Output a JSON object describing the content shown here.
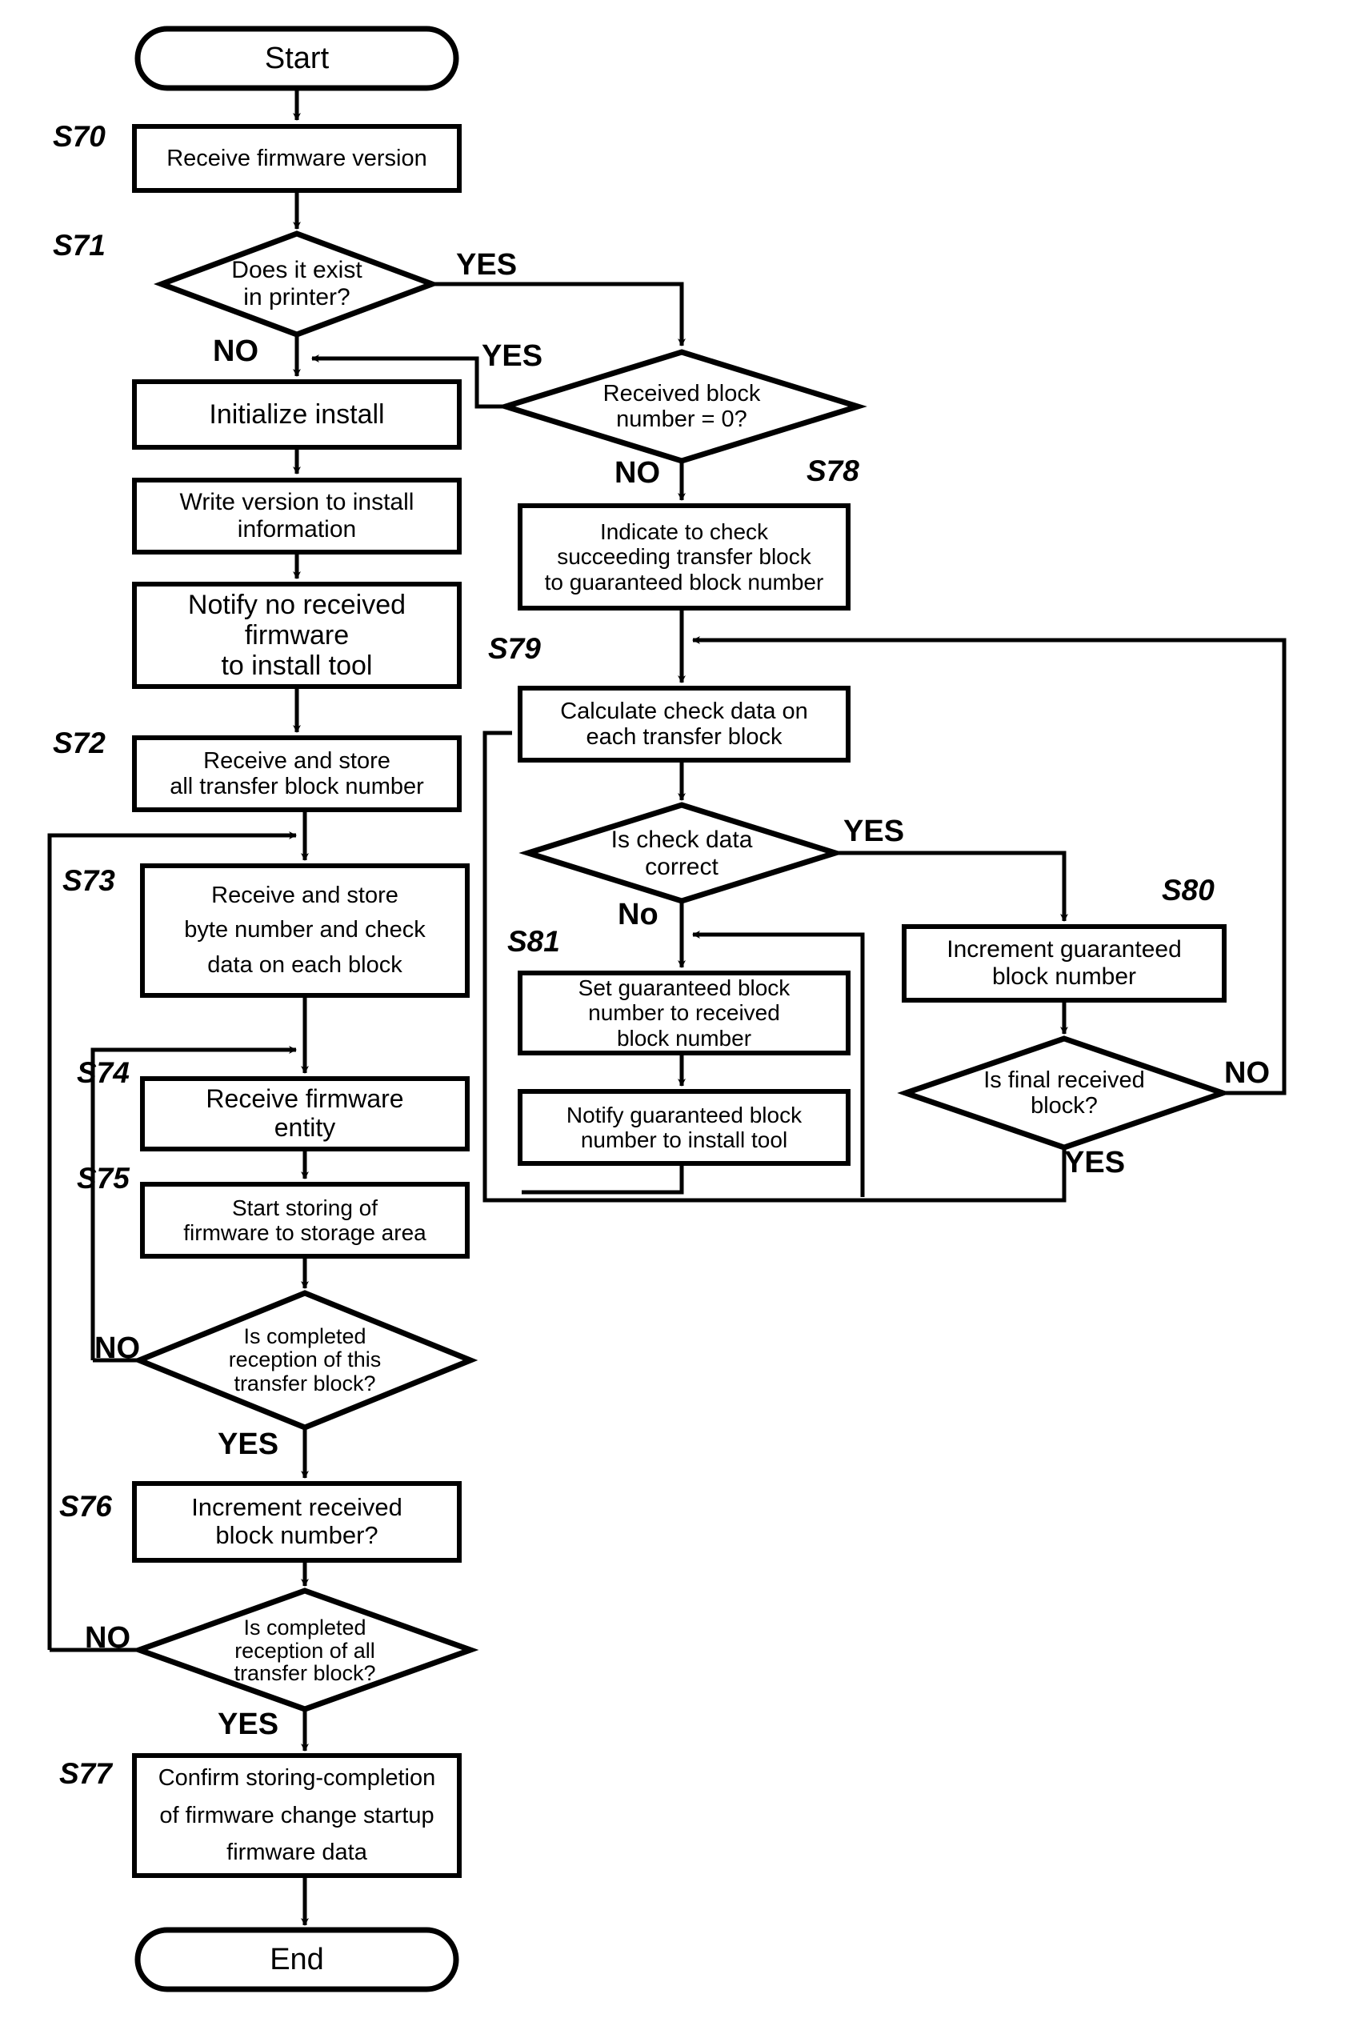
{
  "diagram": {
    "type": "flowchart",
    "title": "Firmware install flowchart (S70-S81)",
    "terminators": {
      "start": "Start",
      "end": "End"
    },
    "nodes": [
      {
        "id": "start",
        "kind": "terminator",
        "step": "",
        "text": "Start"
      },
      {
        "id": "s70",
        "kind": "process",
        "step": "S70",
        "text": "Receive firmware version"
      },
      {
        "id": "s71",
        "kind": "decision",
        "step": "S71",
        "text": "Does it exist\nin printer?"
      },
      {
        "id": "init",
        "kind": "process",
        "step": "",
        "text": "Initialize install"
      },
      {
        "id": "write",
        "kind": "process",
        "step": "",
        "text": "Write version to install\ninformation"
      },
      {
        "id": "notify",
        "kind": "process",
        "step": "",
        "text": "Notify no received\nfirmware\nto install tool"
      },
      {
        "id": "s72",
        "kind": "process",
        "step": "S72",
        "text": "Receive and store\nall transfer block number"
      },
      {
        "id": "s73",
        "kind": "process",
        "step": "S73",
        "text": "Receive and store\nbyte number and check\ndata on each block"
      },
      {
        "id": "s74",
        "kind": "process",
        "step": "S74",
        "text": "Receive firmware\nentity"
      },
      {
        "id": "s75",
        "kind": "process",
        "step": "S75",
        "text": "Start storing of\nfirmware to storage area"
      },
      {
        "id": "dthis",
        "kind": "decision",
        "step": "",
        "text": "Is completed\nreception of this\ntransfer block?"
      },
      {
        "id": "s76",
        "kind": "process",
        "step": "S76",
        "text": "Increment received\nblock number?"
      },
      {
        "id": "dall",
        "kind": "decision",
        "step": "",
        "text": "Is completed\nreception of all\ntransfer block?"
      },
      {
        "id": "s77",
        "kind": "process",
        "step": "S77",
        "text": "Confirm storing-completion\nof firmware change startup\nfirmware data"
      },
      {
        "id": "end",
        "kind": "terminator",
        "step": "",
        "text": "End"
      },
      {
        "id": "drb",
        "kind": "decision",
        "step": "",
        "text": "Received block\nnumber = 0?"
      },
      {
        "id": "s78",
        "kind": "process",
        "step": "S78",
        "text": "Indicate to check\nsucceeding transfer block\nto guaranteed block number"
      },
      {
        "id": "s79",
        "kind": "process",
        "step": "S79",
        "text": "Calculate check data on\neach transfer block"
      },
      {
        "id": "dcheck",
        "kind": "decision",
        "step": "",
        "text": "Is check data\ncorrect"
      },
      {
        "id": "s81a",
        "kind": "process",
        "step": "S81",
        "text": "Set guaranteed block\nnumber to received\nblock number"
      },
      {
        "id": "s81b",
        "kind": "process",
        "step": "",
        "text": "Notify guaranteed block\nnumber to install tool"
      },
      {
        "id": "s80",
        "kind": "process",
        "step": "S80",
        "text": "Increment guaranteed\nblock number"
      },
      {
        "id": "dfinal",
        "kind": "decision",
        "step": "",
        "text": "Is final received\nblock?"
      }
    ],
    "step_labels": [
      "S70",
      "S71",
      "S72",
      "S73",
      "S74",
      "S75",
      "S76",
      "S77",
      "S78",
      "S79",
      "S80",
      "S81"
    ],
    "edge_labels": {
      "s71_yes": "YES",
      "s71_no": "NO",
      "drb_yes": "YES",
      "drb_no": "NO",
      "dcheck_yes": "YES",
      "dcheck_no": "No",
      "dthis_no": "NO",
      "dthis_yes": "YES",
      "dall_no": "NO",
      "dall_yes": "YES",
      "dfinal_no": "NO",
      "dfinal_yes": "YES"
    },
    "colors": {
      "stroke": "#000000",
      "fill": "#ffffff",
      "background": "#ffffff"
    }
  }
}
